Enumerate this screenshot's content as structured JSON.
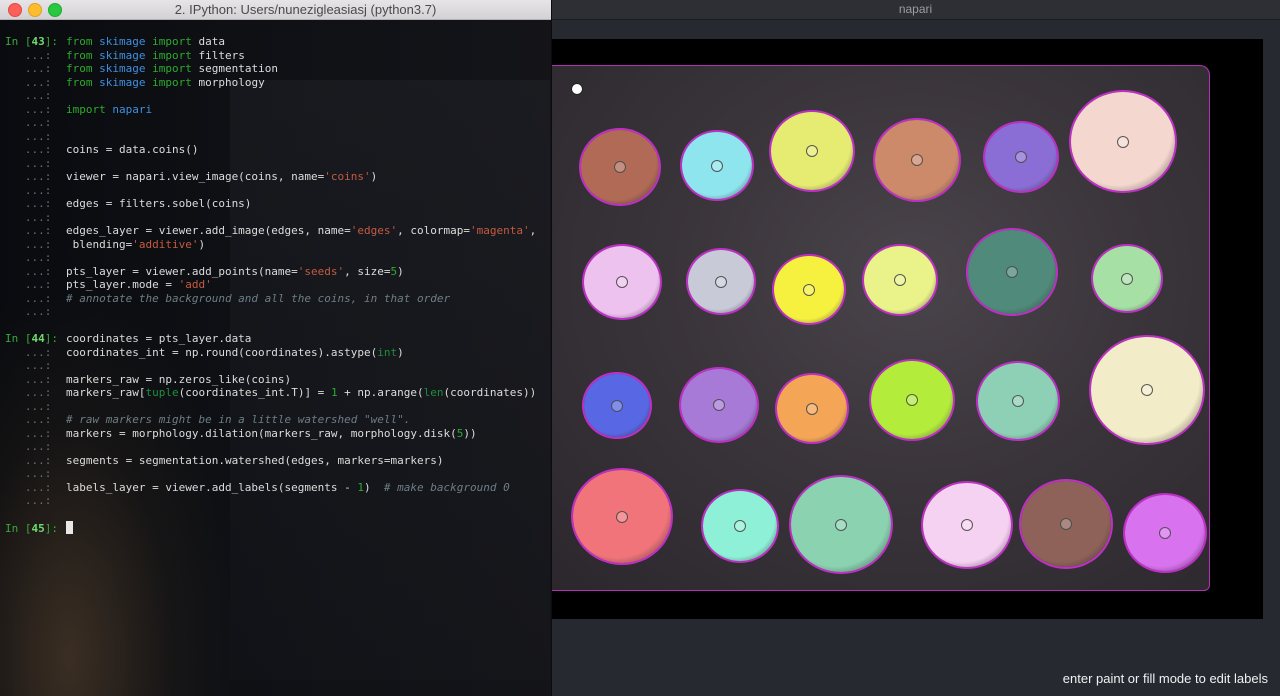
{
  "napari": {
    "title": "napari",
    "status": "enter paint or fill mode to edit labels",
    "coins": [
      {
        "color": "#b06a56"
      },
      {
        "color": "#8fe5ee"
      },
      {
        "color": "#e6ec72"
      },
      {
        "color": "#cd8a6a"
      },
      {
        "color": "#8a6ed6"
      },
      {
        "color": "#f4d8cf"
      },
      {
        "color": "#eec2ef"
      },
      {
        "color": "#c8cad8"
      },
      {
        "color": "#f6f13e"
      },
      {
        "color": "#eaf28a"
      },
      {
        "color": "#4f8a7a"
      },
      {
        "color": "#a6e0a4"
      },
      {
        "color": "#5868e4"
      },
      {
        "color": "#a77ad8"
      },
      {
        "color": "#f5a556"
      },
      {
        "color": "#b4ec3c"
      },
      {
        "color": "#8dd0b6"
      },
      {
        "color": "#f2ecc8"
      },
      {
        "color": "#f0747a"
      },
      {
        "color": "#8ef0d6"
      },
      {
        "color": "#8ad2b0"
      },
      {
        "color": "#f6d2f2"
      },
      {
        "color": "#8e6258"
      },
      {
        "color": "#d872ee"
      }
    ]
  },
  "terminal": {
    "title": "2. IPython: Users/nunezigleasiasj (python3.7)",
    "prompt_in": "In [",
    "prompt_close": "]: ",
    "cont": "   ...: ",
    "cell43": "43",
    "cell44": "44",
    "cell45": "45",
    "kw_from": "from",
    "kw_import": "import",
    "mod_skimage": "skimage",
    "mod_napari": "napari",
    "imp_data": " data",
    "imp_filters": " filters",
    "imp_segmentation": " segmentation",
    "imp_morphology": " morphology",
    "l_coins": "coins = data.coins()",
    "l_viewer_a": "viewer = napari.view_image(coins, name=",
    "s_coins": "'coins'",
    "l_close": ")",
    "l_edges": "edges = filters.sobel(coins)",
    "l_el_a": "edges_layer = viewer.add_image(edges, name=",
    "s_edges": "'edges'",
    "l_el_b": ", colormap=",
    "s_magenta": "'magenta'",
    "l_el_c": ",",
    "l_blend_a": " blending=",
    "s_additive": "'additive'",
    "l_pts_a": "pts_layer = viewer.add_points(name=",
    "s_seeds": "'seeds'",
    "l_pts_b": ", size=",
    "n_5": "5",
    "l_mode_a": "pts_layer.mode = ",
    "s_add": "'add'",
    "c_annotate": "# annotate the background and all the coins, in that order",
    "l_coord": "coordinates = pts_layer.data",
    "l_cint_a": "coordinates_int = np.round(coordinates).astype(",
    "b_int": "int",
    "l_mraw": "markers_raw = np.zeros_like(coins)",
    "l_mraw2_a": "markers_raw[",
    "b_tuple": "tuple",
    "l_mraw2_b": "(coordinates_int.T)] = ",
    "n_1": "1",
    "l_mraw2_c": " + np.arange(",
    "b_len": "len",
    "l_mraw2_d": "(coordinates))",
    "c_raw": "# raw markers might be in a little watershed \"well\".",
    "l_mark_a": "markers = morphology.dilation(markers_raw, morphology.disk(",
    "l_mark_b": "))",
    "l_seg": "segments = segmentation.watershed(edges, markers=markers)",
    "l_lab_a": "labels_layer = viewer.add_labels(segments - ",
    "l_lab_b": ")  ",
    "c_bg": "# make background 0"
  }
}
